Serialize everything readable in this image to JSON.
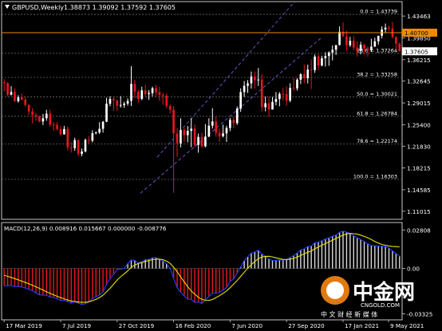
{
  "header": {
    "title": "GBPUSD,Weekly",
    "ohlc": "1.38873 1.39092 1.37592 1.37605"
  },
  "price_panel": {
    "y_ticks": [
      "1.43463",
      "1.39850",
      "1.36215",
      "1.32645",
      "1.29015",
      "1.25400",
      "1.21830",
      "1.18215",
      "1.14585",
      "1.11015"
    ],
    "horizontal_line": {
      "label": "1.40700",
      "value": 1.407,
      "color": "#f08a00"
    },
    "current_price": {
      "label": "1.37605",
      "value": 1.37605
    },
    "fib_levels": [
      {
        "text": "0.0 = 1.43739",
        "value": 1.43739
      },
      {
        "text": "23.6 = 1.37264",
        "value": 1.37264
      },
      {
        "text": "38.2 = 1.33258",
        "value": 1.33258
      },
      {
        "text": "50.0 = 1.30021",
        "value": 1.30021
      },
      {
        "text": "61.8 = 1.26784",
        "value": 1.26784
      },
      {
        "text": "78.6 = 1.22174",
        "value": 1.22174
      },
      {
        "text": "100.0 = 1.16303",
        "value": 1.16303
      }
    ]
  },
  "macd_panel": {
    "label": "MACD(12,26,9) 0.008916 0.015667 0.000000 -0.008776",
    "y_ticks": [
      "0.02808",
      "0.00",
      "-0.03325"
    ]
  },
  "x_axis": {
    "ticks": [
      "17 Mar 2019",
      "7 Jul 2019",
      "27 Oct 2019",
      "16 Feb 2020",
      "7 Jun 2020",
      "27 Sep 2020",
      "17 Jan 2021",
      "9 May 2021"
    ]
  },
  "watermark": {
    "brand": "中金网",
    "domain": "CNGOLD.COM",
    "slogan": "中 文 财 经 新 媒 体"
  },
  "colors": {
    "background": "#000000",
    "bull": "#ffffff",
    "bear": "#e8161e",
    "grid": "#7a7a7a",
    "channel": "#7b59d8",
    "macd_line": "#1f3fff",
    "signal_line": "#e8e000",
    "hist_pos": "#d9d9d9",
    "hist_neg": "#e8161e"
  },
  "chart_data": {
    "type": "candlestick",
    "title": "GBPUSD,Weekly",
    "ylim": [
      1.098,
      1.456
    ],
    "y_scale": "linear",
    "grid": true,
    "legend": "none",
    "x_start_label": "17 Mar 2019",
    "x_end_label": "9 May 2021",
    "candles": [
      [
        1.3247,
        1.3231,
        1.3297,
        1.3095
      ],
      [
        1.3231,
        1.3037,
        1.3242,
        1.3011
      ],
      [
        1.3037,
        1.3084,
        1.3179,
        1.3026
      ],
      [
        1.3084,
        1.2932,
        1.3146,
        1.2919
      ],
      [
        1.2932,
        1.2995,
        1.303,
        1.2906
      ],
      [
        1.2995,
        1.2957,
        1.3056,
        1.2945
      ],
      [
        1.2957,
        1.2868,
        1.3008,
        1.2838
      ],
      [
        1.2868,
        1.2759,
        1.288,
        1.2696
      ],
      [
        1.2759,
        1.2702,
        1.2813,
        1.2561
      ],
      [
        1.2702,
        1.2682,
        1.2738,
        1.2606
      ],
      [
        1.2682,
        1.2593,
        1.2691,
        1.2579
      ],
      [
        1.2593,
        1.2647,
        1.2717,
        1.2533
      ],
      [
        1.2647,
        1.2723,
        1.2788,
        1.2605
      ],
      [
        1.2723,
        1.2539,
        1.2789,
        1.2503
      ],
      [
        1.2539,
        1.2537,
        1.2586,
        1.244
      ],
      [
        1.2537,
        1.2468,
        1.2582,
        1.2444
      ],
      [
        1.2468,
        1.238,
        1.252,
        1.2358
      ],
      [
        1.238,
        1.2469,
        1.2521,
        1.2375
      ],
      [
        1.2469,
        1.2164,
        1.251,
        1.2117
      ],
      [
        1.2164,
        1.2149,
        1.225,
        1.2078
      ],
      [
        1.2149,
        1.2284,
        1.2323,
        1.2105
      ],
      [
        1.2284,
        1.2055,
        1.2295,
        1.2015
      ],
      [
        1.2055,
        1.2095,
        1.2145,
        1.2015
      ],
      [
        1.2095,
        1.2288,
        1.231,
        1.2079
      ],
      [
        1.2288,
        1.2274,
        1.2353,
        1.2226
      ],
      [
        1.2274,
        1.2399,
        1.2448,
        1.2247
      ],
      [
        1.2399,
        1.241,
        1.2427,
        1.2379
      ],
      [
        1.241,
        1.2471,
        1.2582,
        1.2385
      ],
      [
        1.2471,
        1.259,
        1.2602,
        1.241
      ],
      [
        1.259,
        1.2889,
        1.2988,
        1.2582
      ],
      [
        1.2889,
        1.2968,
        1.3013,
        1.2848
      ],
      [
        1.2968,
        1.2941,
        1.3012,
        1.277
      ],
      [
        1.2941,
        1.2858,
        1.2959,
        1.277
      ],
      [
        1.2858,
        1.2867,
        1.3016,
        1.2824
      ],
      [
        1.2867,
        1.2891,
        1.2923,
        1.2818
      ],
      [
        1.2891,
        1.2935,
        1.2978,
        1.2855
      ],
      [
        1.2935,
        1.3218,
        1.3514,
        1.2851
      ],
      [
        1.3218,
        1.309,
        1.3287,
        1.2982
      ],
      [
        1.309,
        1.2969,
        1.3118,
        1.2905
      ],
      [
        1.2969,
        1.3112,
        1.3173,
        1.2947
      ],
      [
        1.3112,
        1.3049,
        1.3208,
        1.3012
      ],
      [
        1.3049,
        1.3066,
        1.3117,
        1.2953
      ],
      [
        1.3066,
        1.3147,
        1.3173,
        1.3013
      ],
      [
        1.3147,
        1.308,
        1.3205,
        1.3013
      ],
      [
        1.308,
        1.3034,
        1.3168,
        1.2938
      ],
      [
        1.3034,
        1.3022,
        1.3072,
        1.287
      ],
      [
        1.3022,
        1.285,
        1.306,
        1.2813
      ],
      [
        1.285,
        1.2789,
        1.288,
        1.2725
      ],
      [
        1.2789,
        1.2394,
        1.2849,
        1.1409
      ],
      [
        1.2394,
        1.2229,
        1.2485,
        1.2005
      ],
      [
        1.2229,
        1.2451,
        1.2647,
        1.2163
      ],
      [
        1.2451,
        1.2366,
        1.2485,
        1.2255
      ],
      [
        1.2366,
        1.2437,
        1.2519,
        1.2248
      ],
      [
        1.2437,
        1.2474,
        1.2648,
        1.2165
      ],
      [
        1.2474,
        1.2204,
        1.2546,
        1.2164
      ],
      [
        1.2204,
        1.2337,
        1.2392,
        1.2075
      ],
      [
        1.2337,
        1.218,
        1.2405,
        1.216
      ],
      [
        1.218,
        1.2342,
        1.255,
        1.2164
      ],
      [
        1.2342,
        1.2523,
        1.2647,
        1.2333
      ],
      [
        1.2523,
        1.2593,
        1.2814,
        1.2476
      ],
      [
        1.2593,
        1.2404,
        1.2688,
        1.2341
      ],
      [
        1.2404,
        1.2349,
        1.2477,
        1.2252
      ],
      [
        1.2349,
        1.2395,
        1.2541,
        1.2331
      ],
      [
        1.2395,
        1.2485,
        1.2522,
        1.2252
      ],
      [
        1.2485,
        1.262,
        1.2653,
        1.2433
      ],
      [
        1.262,
        1.2566,
        1.267,
        1.248
      ],
      [
        1.2566,
        1.2808,
        1.2843,
        1.2537
      ],
      [
        1.2808,
        1.3083,
        1.3145,
        1.2753
      ],
      [
        1.3083,
        1.3187,
        1.3267,
        1.3004
      ],
      [
        1.3187,
        1.3227,
        1.3282,
        1.3068
      ],
      [
        1.3227,
        1.3342,
        1.3424,
        1.314
      ],
      [
        1.3342,
        1.328,
        1.3426,
        1.3137
      ],
      [
        1.328,
        1.3291,
        1.3483,
        1.3185
      ],
      [
        1.3291,
        1.2831,
        1.3378,
        1.2758
      ],
      [
        1.2831,
        1.2896,
        1.3008,
        1.2762
      ],
      [
        1.2896,
        1.2792,
        1.3009,
        1.2674
      ],
      [
        1.2792,
        1.2919,
        1.3003,
        1.2806
      ],
      [
        1.2919,
        1.2967,
        1.3083,
        1.2863
      ],
      [
        1.2967,
        1.3052,
        1.3082,
        1.2845
      ],
      [
        1.3052,
        1.3048,
        1.315,
        1.2942
      ],
      [
        1.3048,
        1.2941,
        1.3177,
        1.2854
      ],
      [
        1.2941,
        1.3151,
        1.323,
        1.2915
      ],
      [
        1.3151,
        1.3146,
        1.3314,
        1.3105
      ],
      [
        1.3146,
        1.3288,
        1.3313,
        1.3107
      ],
      [
        1.3288,
        1.3378,
        1.3398,
        1.3215
      ],
      [
        1.3378,
        1.3312,
        1.3539,
        1.3227
      ],
      [
        1.3312,
        1.3456,
        1.3539,
        1.3225
      ],
      [
        1.3456,
        1.3448,
        1.3625,
        1.3134
      ],
      [
        1.3448,
        1.3673,
        1.3707,
        1.3402
      ],
      [
        1.3673,
        1.3524,
        1.3711,
        1.3451
      ],
      [
        1.3524,
        1.3645,
        1.3688,
        1.351
      ],
      [
        1.3645,
        1.3682,
        1.3745,
        1.3507
      ],
      [
        1.3682,
        1.374,
        1.3759,
        1.352
      ],
      [
        1.374,
        1.3786,
        1.3858,
        1.3609
      ],
      [
        1.3786,
        1.3865,
        1.386,
        1.37
      ],
      [
        1.3865,
        1.4085,
        1.4174,
        1.3856
      ],
      [
        1.4085,
        1.4007,
        1.4241,
        1.4005
      ],
      [
        1.4007,
        1.3861,
        1.4101,
        1.3775
      ],
      [
        1.3861,
        1.3934,
        1.4001,
        1.3833
      ],
      [
        1.3934,
        1.3822,
        1.4017,
        1.378
      ],
      [
        1.3822,
        1.3765,
        1.3927,
        1.3673
      ],
      [
        1.3765,
        1.3868,
        1.3918,
        1.3709
      ],
      [
        1.3868,
        1.3807,
        1.3886,
        1.3709
      ],
      [
        1.3807,
        1.3777,
        1.3842,
        1.3671
      ],
      [
        1.3777,
        1.3838,
        1.3968,
        1.3749
      ],
      [
        1.3838,
        1.3926,
        1.3986,
        1.3833
      ],
      [
        1.3926,
        1.4019,
        1.4004,
        1.3871
      ],
      [
        1.4019,
        1.4124,
        1.4178,
        1.3975
      ],
      [
        1.4124,
        1.4153,
        1.4221,
        1.4076
      ],
      [
        1.4153,
        1.414,
        1.419,
        1.4093
      ],
      [
        1.414,
        1.3997,
        1.425,
        1.3975
      ],
      [
        1.3997,
        1.3887,
        1.4005,
        1.3787
      ],
      [
        1.3887,
        1.376,
        1.3909,
        1.3759
      ]
    ],
    "macd": [
      -0.0128,
      -0.0127,
      -0.0124,
      -0.0132,
      -0.0133,
      -0.0136,
      -0.0143,
      -0.0154,
      -0.0163,
      -0.0178,
      -0.0193,
      -0.0196,
      -0.0196,
      -0.0209,
      -0.0212,
      -0.0222,
      -0.0234,
      -0.0234,
      -0.0243,
      -0.0254,
      -0.0244,
      -0.0254,
      -0.0264,
      -0.0258,
      -0.0244,
      -0.0221,
      -0.0207,
      -0.0194,
      -0.0172,
      -0.0114,
      -0.0075,
      -0.0043,
      -0.0008,
      -0.0005,
      0.0001,
      0.0035,
      0.0062,
      0.0059,
      0.0039,
      0.0049,
      0.0065,
      0.0066,
      0.0079,
      0.0078,
      0.0067,
      0.0054,
      0.0034,
      0.0002,
      -0.0072,
      -0.0141,
      -0.0173,
      -0.0202,
      -0.0225,
      -0.0226,
      -0.0249,
      -0.0245,
      -0.0257,
      -0.0231,
      -0.0206,
      -0.0182,
      -0.018,
      -0.0177,
      -0.0159,
      -0.014,
      -0.0094,
      -0.0078,
      -0.0035,
      0.0013,
      0.0057,
      0.0085,
      0.0112,
      0.012,
      0.0133,
      0.0106,
      0.0088,
      0.007,
      0.0058,
      0.0058,
      0.0062,
      0.006,
      0.0066,
      0.008,
      0.0094,
      0.0113,
      0.0135,
      0.0143,
      0.016,
      0.0164,
      0.0188,
      0.0192,
      0.0202,
      0.0215,
      0.0224,
      0.0235,
      0.0244,
      0.0264,
      0.0272,
      0.0265,
      0.0256,
      0.0239,
      0.0224,
      0.0212,
      0.0196,
      0.0179,
      0.0168,
      0.0165,
      0.0162,
      0.0163,
      0.0161,
      0.0149,
      0.0128,
      0.0109,
      0.0089
    ],
    "signal": [
      -0.005,
      -0.0058,
      -0.0066,
      -0.0075,
      -0.0083,
      -0.0093,
      -0.0103,
      -0.0113,
      -0.0123,
      -0.0134,
      -0.0146,
      -0.0158,
      -0.017,
      -0.0182,
      -0.0193,
      -0.0204,
      -0.0213,
      -0.0222,
      -0.0231,
      -0.0238,
      -0.0242,
      -0.0246,
      -0.0248,
      -0.0247,
      -0.0244,
      -0.0236,
      -0.0226,
      -0.0213,
      -0.0196,
      -0.0171,
      -0.0145,
      -0.0116,
      -0.0085,
      -0.0061,
      -0.004,
      -0.0018,
      0.0008,
      0.0025,
      0.0036,
      0.0043,
      0.0051,
      0.0058,
      0.0064,
      0.0068,
      0.0068,
      0.0063,
      0.0053,
      0.0037,
      0.0009,
      -0.0024,
      -0.0062,
      -0.0099,
      -0.0134,
      -0.0165,
      -0.0189,
      -0.0211,
      -0.0226,
      -0.0233,
      -0.0234,
      -0.0227,
      -0.0213,
      -0.0199,
      -0.0183,
      -0.0165,
      -0.0141,
      -0.0116,
      -0.0089,
      -0.0058,
      -0.0028,
      0.0001,
      0.0027,
      0.0051,
      0.0071,
      0.0083,
      0.0088,
      0.0089,
      0.0084,
      0.0077,
      0.0071,
      0.0066,
      0.0065,
      0.0068,
      0.0073,
      0.0083,
      0.0094,
      0.0106,
      0.0118,
      0.0128,
      0.0143,
      0.0157,
      0.0169,
      0.0181,
      0.0194,
      0.0206,
      0.0219,
      0.0231,
      0.0244,
      0.0252,
      0.0256,
      0.0254,
      0.025,
      0.0243,
      0.0234,
      0.0223,
      0.0211,
      0.0197,
      0.0185,
      0.0175,
      0.0169,
      0.0164,
      0.0161,
      0.0159,
      0.0157
    ]
  }
}
